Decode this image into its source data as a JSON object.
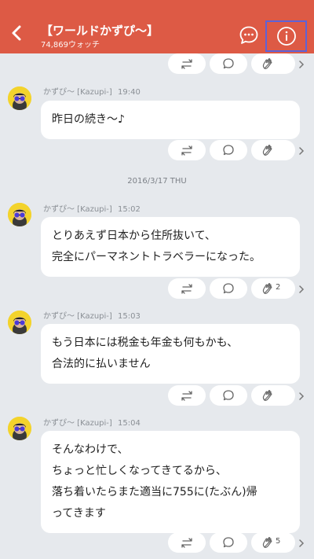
{
  "header": {
    "title": "【ワールドかずぴ〜】",
    "watch_count": "74,869ウォッチ"
  },
  "date_separator": "2016/3/17 THU",
  "messages": [
    {
      "author": "かずぴ〜 [Kazupi-]",
      "time": "19:40",
      "text": "昨日の続き〜♪",
      "clap_count": ""
    },
    {
      "author": "かずぴ〜 [Kazupi-]",
      "time": "15:02",
      "text": "とりあえず日本から住所抜いて、\n完全にパーマネントトラベラーになった。",
      "clap_count": "2"
    },
    {
      "author": "かずぴ〜 [Kazupi-]",
      "time": "15:03",
      "text": "もう日本には税金も年金も何もかも、\n合法的に払いません",
      "clap_count": ""
    },
    {
      "author": "かずぴ〜 [Kazupi-]",
      "time": "15:04",
      "text": "そんなわけで、\nちょっと忙しくなってきてるから、\n落ち着いたらまた適当に755に(たぶん)帰\nってきます",
      "clap_count": "5"
    }
  ],
  "colors": {
    "header_bg": "#dd5a45",
    "background": "#e6e9ed",
    "highlight_border": "#5d63d8",
    "avatar_bg": "#f3d32c"
  }
}
